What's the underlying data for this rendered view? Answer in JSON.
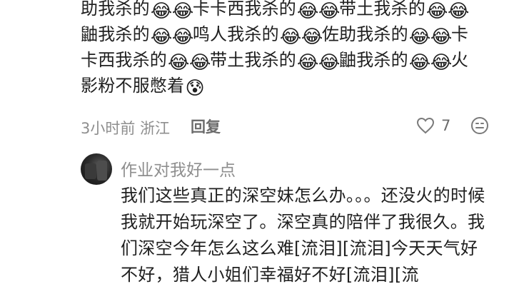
{
  "comment": {
    "line1": [
      "助我杀的",
      "😂",
      "😂",
      "卡卡西我杀的",
      "😂",
      "😂",
      "带土我杀的",
      "😂",
      "😂"
    ],
    "line2": [
      "鼬我杀的",
      "😂",
      "😂",
      "鸣人我杀的",
      "😂",
      "😂",
      "佐助我杀的",
      "😂",
      "😂",
      "卡"
    ],
    "line3": [
      "卡西我杀的",
      "😂",
      "😂",
      "带土我杀的",
      "😂",
      "😂",
      "鼬我杀的",
      "😂",
      "😂",
      "火"
    ],
    "line4": [
      "影粉不服憋着",
      "😰"
    ],
    "time_location": "3小时前 浙江",
    "reply_label": "回复",
    "like_count": "7",
    "icons": {
      "like": "heart-outline-icon",
      "more": "emoji-face-icon"
    }
  },
  "reply": {
    "username": "作业对我好一点",
    "avatar": "avatar",
    "text": "我们这些真正的深空妹怎么办。。。还没火的时候我就开始玩深空了。深空真的陪伴了我很久。我们深空今年怎么这么难[流泪][流泪]今天天气好不好，猎人小姐们幸福好不好[流泪][流"
  }
}
